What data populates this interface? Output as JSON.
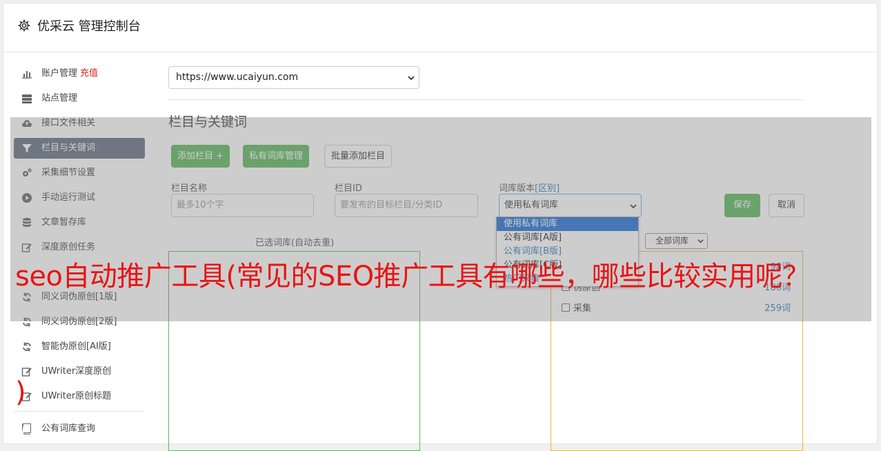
{
  "app": {
    "title": "优采云 管理控制台"
  },
  "sidebar": {
    "items": [
      {
        "label": "账户管理",
        "badge": "充值",
        "icon": "bar-chart-icon"
      },
      {
        "label": "站点管理",
        "icon": "server-icon"
      },
      {
        "label": "接口文件相关",
        "icon": "cloud-upload-icon"
      },
      {
        "label": "栏目与关键词",
        "icon": "filter-icon",
        "active": true
      },
      {
        "label": "采集细节设置",
        "icon": "gears-icon"
      },
      {
        "label": "手动运行测试",
        "icon": "play-circle-icon"
      },
      {
        "label": "文章暂存库",
        "icon": "database-icon"
      },
      {
        "label": "深度原创任务",
        "icon": "edit-icon"
      },
      {
        "label": "",
        "icon": ""
      },
      {
        "label": "同义词伪原创[1版]",
        "icon": "refresh-icon"
      },
      {
        "label": "同义词伪原创[2版]",
        "icon": "refresh-icon"
      },
      {
        "label": "智能伪原创[AI版]",
        "icon": "refresh-icon"
      },
      {
        "label": "UWriter深度原创",
        "icon": "edit-icon"
      },
      {
        "label": "UWriter原创标题",
        "icon": "edit-icon"
      }
    ],
    "bottom_item": {
      "label": "公有词库查询",
      "icon": "book-icon"
    }
  },
  "main": {
    "site_select": {
      "value": "https://www.ucaiyun.com"
    },
    "section_title": "栏目与关键词",
    "buttons": {
      "add_column": "添加栏目 +",
      "private_lib": "私有词库管理",
      "batch_add": "批量添加栏目"
    },
    "form": {
      "name_label": "栏目名称",
      "name_placeholder": "最多10个字",
      "id_label": "栏目ID",
      "id_placeholder": "要发布的目标栏目/分类ID",
      "version_label": "词库版本",
      "version_hint": "[区别]",
      "version_value": "使用私有词库",
      "version_options": [
        "使用私有词库",
        "公有词库[A版]",
        "公有词库[B版]",
        "公有词库[C版]",
        "热门采集"
      ],
      "save": "保存",
      "cancel": "取消"
    },
    "selected_title": "已选词库(自动去重)",
    "lib_filter": "全部词库",
    "libs": [
      {
        "name": "",
        "count": "98词"
      },
      {
        "name": "伪原创",
        "count": "186词"
      },
      {
        "name": "采集",
        "count": "259词"
      }
    ]
  },
  "banner": {
    "headline": "seo自动推广工具(常见的SEO推广工具有哪些，哪些比较实用呢？",
    "tail": ")"
  },
  "colors": {
    "green": "#5cb85c",
    "active_nav": "#5f6f80",
    "link": "#337ab7",
    "headline": "#e81414"
  }
}
